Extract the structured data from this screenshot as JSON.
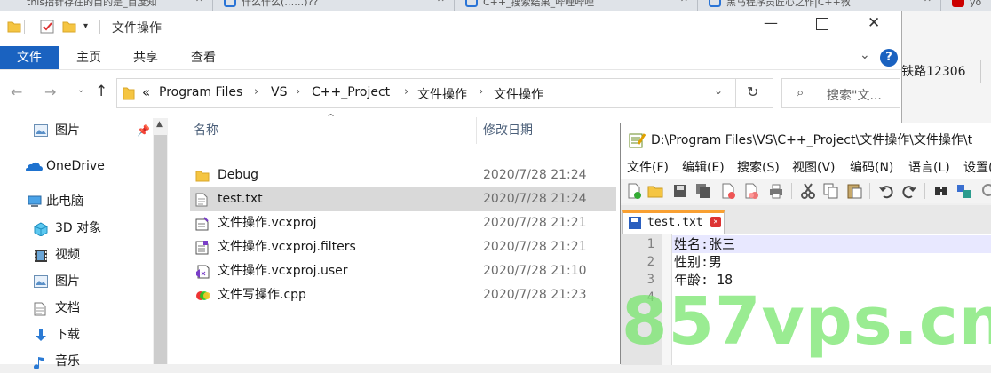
{
  "browser": {
    "tabs": [
      {
        "label": "this指针存在的目的是_百度知"
      },
      {
        "label": "什么什么(……)??"
      },
      {
        "label": "C++_搜索结果_哔哩哔哩"
      },
      {
        "label": "黑马程序员匠心之作|C++教"
      },
      {
        "label": "yo"
      }
    ],
    "side_text": "铁路12306"
  },
  "explorer": {
    "title": "文件操作",
    "ribbon": {
      "file": "文件",
      "home": "主页",
      "share": "共享",
      "view": "查看"
    },
    "address": {
      "overflow": "«",
      "crumbs": [
        "Program Files",
        "VS",
        "C++_Project",
        "文件操作",
        "文件操作"
      ]
    },
    "search_placeholder": "搜索\"文...",
    "nav": [
      {
        "label": "图片",
        "icon": "pictures-icon",
        "pinned": true
      },
      {
        "label": "OneDrive",
        "icon": "onedrive-icon"
      },
      {
        "label": "此电脑",
        "icon": "this-pc-icon"
      },
      {
        "label": "3D 对象",
        "icon": "3d-objects-icon"
      },
      {
        "label": "视频",
        "icon": "videos-icon"
      },
      {
        "label": "图片",
        "icon": "pictures-icon"
      },
      {
        "label": "文档",
        "icon": "documents-icon"
      },
      {
        "label": "下载",
        "icon": "downloads-icon"
      },
      {
        "label": "音乐",
        "icon": "music-icon"
      }
    ],
    "columns": {
      "name": "名称",
      "date": "修改日期"
    },
    "files": [
      {
        "name": "Debug",
        "date": "2020/7/28 21:24",
        "icon": "folder-icon"
      },
      {
        "name": "test.txt",
        "date": "2020/7/28 21:24",
        "icon": "text-file-icon",
        "selected": true
      },
      {
        "name": "文件操作.vcxproj",
        "date": "2020/7/28 21:21",
        "icon": "vcxproj-icon"
      },
      {
        "name": "文件操作.vcxproj.filters",
        "date": "2020/7/28 21:21",
        "icon": "filters-file-icon"
      },
      {
        "name": "文件操作.vcxproj.user",
        "date": "2020/7/28 21:10",
        "icon": "vs-user-file-icon"
      },
      {
        "name": "文件写操作.cpp",
        "date": "2020/7/28 21:23",
        "icon": "cpp-file-icon"
      }
    ]
  },
  "notepad": {
    "title": "D:\\Program Files\\VS\\C++_Project\\文件操作\\文件操作\\t",
    "menu": [
      "文件(F)",
      "编辑(E)",
      "搜索(S)",
      "视图(V)",
      "编码(N)",
      "语言(L)",
      "设置("
    ],
    "tab_label": "test.txt",
    "lines": [
      {
        "num": "1",
        "text": "姓名:张三"
      },
      {
        "num": "2",
        "text": "性别:男"
      },
      {
        "num": "3",
        "text": "年龄: 18"
      },
      {
        "num": "4",
        "text": ""
      }
    ]
  },
  "watermark": "857vps.cn",
  "colors": {
    "accent": "#1a62c0",
    "selected_row": "#d9d9d9",
    "npp_tab_accent": "#f9a032",
    "watermark": "#78e66e"
  }
}
